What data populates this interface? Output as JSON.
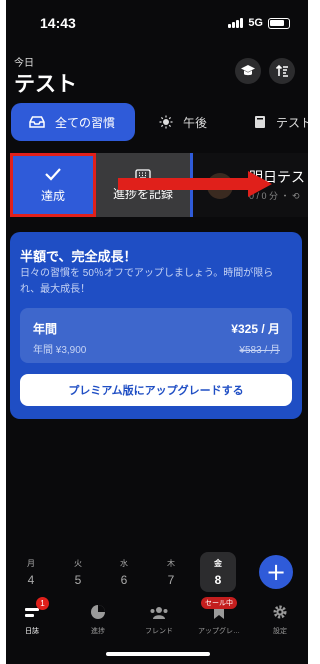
{
  "status_bar": {
    "time": "14:43",
    "network": "5G"
  },
  "header": {
    "subtitle": "今日",
    "title": "テスト"
  },
  "header_buttons": {
    "left_icon": "graduation-cap-icon",
    "right_icon": "sort-icon"
  },
  "category_tabs": [
    {
      "label": "全ての習慣",
      "icon": "inbox-icon",
      "selected": true
    },
    {
      "label": "午後",
      "icon": "sun-icon",
      "selected": false
    },
    {
      "label": "テスト",
      "icon": "book-icon",
      "selected": false
    }
  ],
  "swipe_actions": {
    "done_label": "達成",
    "record_label": "進捗を記録"
  },
  "habit": {
    "title": "明日テスト",
    "subtitle": "0 / 0 分 ・ ⟲"
  },
  "promo": {
    "title": "半額で、完全成長！",
    "description": "日々の習慣を 50％オフでアップしましょう。時間が限られ、最大成長！",
    "plan_name": "年間",
    "plan_price": "¥325 / 月",
    "plan_yearly": "年間 ¥3,900",
    "plan_original": "¥583 / 月",
    "button_label": "プレミアム版にアップグレードする"
  },
  "days": [
    {
      "dow": "月",
      "num": "4"
    },
    {
      "dow": "火",
      "num": "5"
    },
    {
      "dow": "水",
      "num": "6"
    },
    {
      "dow": "木",
      "num": "7"
    },
    {
      "dow": "金",
      "num": "8",
      "active": true
    }
  ],
  "tabbar": [
    {
      "label": "日誌",
      "badge": "1",
      "active": true
    },
    {
      "label": "進捗"
    },
    {
      "label": "フレンド"
    },
    {
      "label": "アップグレ…",
      "badge": "セール中"
    },
    {
      "label": "設定"
    }
  ],
  "colors": {
    "accent": "#2f5bd9",
    "promo_bg": "#1f4ec4",
    "highlight_red": "#e0201b"
  }
}
